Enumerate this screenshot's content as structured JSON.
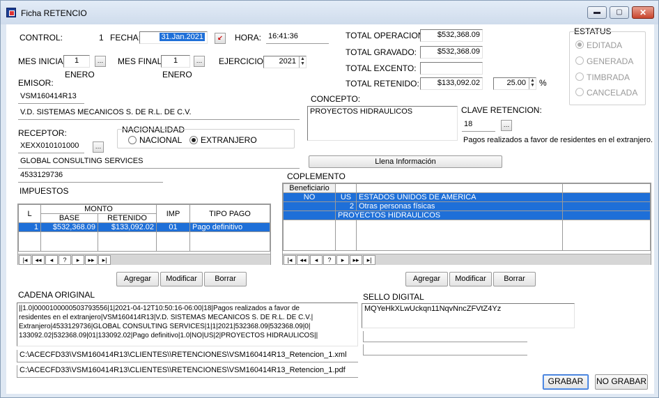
{
  "window": {
    "title": "Ficha RETENCIO",
    "min_label": "▬",
    "max_label": "▢",
    "close_label": "✕"
  },
  "header": {
    "control_label": "CONTROL:",
    "control_value": "1",
    "fecha_label": "FECHA:",
    "fecha_value": "31.Jan.2021",
    "hora_label": "HORA:",
    "hora_value": "16:41:36",
    "mes_inicia_label": "MES INICIA:",
    "mes_inicia_value": "1",
    "mes_inicia_name": "ENERO",
    "mes_final_label": "MES FINAL:",
    "mes_final_value": "1",
    "mes_final_name": "ENERO",
    "ejercicio_label": "EJERCICIO",
    "ejercicio_value": "2021"
  },
  "totals": {
    "operacion_label": "TOTAL OPERACION:",
    "operacion_value": "$532,368.09",
    "gravado_label": "TOTAL GRAVADO:",
    "gravado_value": "$532,368.09",
    "excento_label": "TOTAL EXCENTO:",
    "excento_value": "",
    "retenido_label": "TOTAL RETENIDO:",
    "retenido_value": "$133,092.02",
    "porcentaje_value": "25.00",
    "porcentaje_symbol": "%"
  },
  "estatus": {
    "title": "ESTATUS",
    "options": [
      "EDITADA",
      "GENERADA",
      "TIMBRADA",
      "CANCELADA"
    ],
    "selected": "EDITADA"
  },
  "emisor": {
    "label": "EMISOR:",
    "rfc": "VSM160414R13",
    "nombre": "V.D. SISTEMAS MECANICOS S. DE R.L. DE C.V."
  },
  "receptor": {
    "label": "RECEPTOR:",
    "rfc": "XEXX010101000",
    "nacionalidad_title": "NACIONALIDAD",
    "nacional_label": "NACIONAL",
    "extranjero_label": "EXTRANJERO",
    "selected": "EXTRANJERO",
    "nombre": "GLOBAL CONSULTING SERVICES",
    "num_reg": "4533129736"
  },
  "concepto": {
    "label": "CONCEPTO:",
    "value": "PROYECTOS HIDRAULICOS",
    "clave_label": "CLAVE RETENCION:",
    "clave_value": "18",
    "clave_desc": "Pagos realizados a favor de residentes en el extranjero."
  },
  "llena_button": "Llena Información",
  "impuestos": {
    "title": "IMPUESTOS",
    "headers": {
      "l": "L",
      "monto": "MONTO",
      "base": "BASE",
      "retenido": "RETENIDO",
      "imp": "IMP",
      "tipo_pago": "TIPO PAGO"
    },
    "rows": [
      {
        "l": "1",
        "base": "$532,368.09",
        "retenido": "$133,092.02",
        "imp": "01",
        "tipo_pago": "Pago definitivo"
      }
    ],
    "buttons": {
      "agregar": "Agregar",
      "modificar": "Modificar",
      "borrar": "Borrar"
    }
  },
  "complemento": {
    "title": "COPLEMENTO",
    "header_beneficiario": "Beneficiario",
    "rows": [
      {
        "beneficiario": "NO",
        "code": "US",
        "desc": "ESTADOS UNIDOS DE AMERICA"
      },
      {
        "beneficiario": "",
        "code": "2",
        "desc": "Otras personas físicas"
      },
      {
        "beneficiario": "",
        "code": "",
        "desc": "PROYECTOS HIDRAULICOS"
      }
    ],
    "buttons": {
      "agregar": "Agregar",
      "modificar": "Modificar",
      "borrar": "Borrar"
    }
  },
  "navigator": [
    "|◂",
    "◂◂",
    "◂",
    "?",
    "▸",
    "▸▸",
    "▸|"
  ],
  "cadena": {
    "label": "CADENA ORIGINAL",
    "lines": [
      "||1.0|0000100000503793556|1|2021-04-12T10:50:16-06:00|18|Pagos realizados a favor de",
      "residentes en el extranjero|VSM160414R13|V.D. SISTEMAS MECANICOS S. DE R.L. DE C.V.|",
      "Extranjero|4533129736|GLOBAL CONSULTING SERVICES|1|1|2021|532368.09|532368.09|0|",
      "133092.02|532368.09|01|133092.02|Pago definitivo|1.0|NO|US|2|PROYECTOS HIDRAULICOS||"
    ]
  },
  "sello": {
    "label": "SELLO DIGITAL",
    "value": "MQYeHkXLwUckqn11NqvNncZFVtZ4Yz"
  },
  "files": {
    "xml": "C:\\ACECFD33\\VSM160414R13\\CLIENTES\\\\RETENCIONES\\VSM160414R13_Retencion_1.xml",
    "pdf": "C:\\ACECFD33\\VSM160414R13\\CLIENTES\\\\RETENCIONES\\VSM160414R13_Retencion_1.pdf"
  },
  "actions": {
    "grabar": "GRABAR",
    "no_grabar": "NO GRABAR"
  }
}
